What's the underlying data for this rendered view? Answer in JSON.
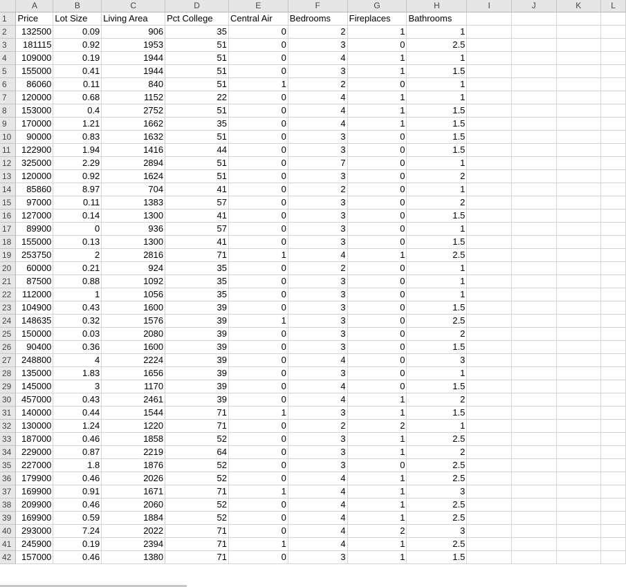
{
  "columns": [
    "A",
    "B",
    "C",
    "D",
    "E",
    "F",
    "G",
    "H",
    "I",
    "J",
    "K",
    "L"
  ],
  "headers": [
    "Price",
    "Lot Size",
    "Living Area",
    "Pct College",
    "Central Air",
    "Bedrooms",
    "Fireplaces",
    "Bathrooms"
  ],
  "rows": [
    [
      132500,
      0.09,
      906,
      35,
      0,
      2,
      1,
      1
    ],
    [
      181115,
      0.92,
      1953,
      51,
      0,
      3,
      0,
      2.5
    ],
    [
      109000,
      0.19,
      1944,
      51,
      0,
      4,
      1,
      1
    ],
    [
      155000,
      0.41,
      1944,
      51,
      0,
      3,
      1,
      1.5
    ],
    [
      86060,
      0.11,
      840,
      51,
      1,
      2,
      0,
      1
    ],
    [
      120000,
      0.68,
      1152,
      22,
      0,
      4,
      1,
      1
    ],
    [
      153000,
      0.4,
      2752,
      51,
      0,
      4,
      1,
      1.5
    ],
    [
      170000,
      1.21,
      1662,
      35,
      0,
      4,
      1,
      1.5
    ],
    [
      90000,
      0.83,
      1632,
      51,
      0,
      3,
      0,
      1.5
    ],
    [
      122900,
      1.94,
      1416,
      44,
      0,
      3,
      0,
      1.5
    ],
    [
      325000,
      2.29,
      2894,
      51,
      0,
      7,
      0,
      1
    ],
    [
      120000,
      0.92,
      1624,
      51,
      0,
      3,
      0,
      2
    ],
    [
      85860,
      8.97,
      704,
      41,
      0,
      2,
      0,
      1
    ],
    [
      97000,
      0.11,
      1383,
      57,
      0,
      3,
      0,
      2
    ],
    [
      127000,
      0.14,
      1300,
      41,
      0,
      3,
      0,
      1.5
    ],
    [
      89900,
      0,
      936,
      57,
      0,
      3,
      0,
      1
    ],
    [
      155000,
      0.13,
      1300,
      41,
      0,
      3,
      0,
      1.5
    ],
    [
      253750,
      2,
      2816,
      71,
      1,
      4,
      1,
      2.5
    ],
    [
      60000,
      0.21,
      924,
      35,
      0,
      2,
      0,
      1
    ],
    [
      87500,
      0.88,
      1092,
      35,
      0,
      3,
      0,
      1
    ],
    [
      112000,
      1,
      1056,
      35,
      0,
      3,
      0,
      1
    ],
    [
      104900,
      0.43,
      1600,
      39,
      0,
      3,
      0,
      1.5
    ],
    [
      148635,
      0.32,
      1576,
      39,
      1,
      3,
      0,
      2.5
    ],
    [
      150000,
      0.03,
      2080,
      39,
      0,
      3,
      0,
      2
    ],
    [
      90400,
      0.36,
      1600,
      39,
      0,
      3,
      0,
      1.5
    ],
    [
      248800,
      4,
      2224,
      39,
      0,
      4,
      0,
      3
    ],
    [
      135000,
      1.83,
      1656,
      39,
      0,
      3,
      0,
      1
    ],
    [
      145000,
      3,
      1170,
      39,
      0,
      4,
      0,
      1.5
    ],
    [
      457000,
      0.43,
      2461,
      39,
      0,
      4,
      1,
      2
    ],
    [
      140000,
      0.44,
      1544,
      71,
      1,
      3,
      1,
      1.5
    ],
    [
      130000,
      1.24,
      1220,
      71,
      0,
      2,
      2,
      1
    ],
    [
      187000,
      0.46,
      1858,
      52,
      0,
      3,
      1,
      2.5
    ],
    [
      229000,
      0.87,
      2219,
      64,
      0,
      3,
      1,
      2
    ],
    [
      227000,
      1.8,
      1876,
      52,
      0,
      3,
      0,
      2.5
    ],
    [
      179900,
      0.46,
      2026,
      52,
      0,
      4,
      1,
      2.5
    ],
    [
      169900,
      0.91,
      1671,
      71,
      1,
      4,
      1,
      3
    ],
    [
      209900,
      0.46,
      2060,
      52,
      0,
      4,
      1,
      2.5
    ],
    [
      169900,
      0.59,
      1884,
      52,
      0,
      4,
      1,
      2.5
    ],
    [
      293000,
      7.24,
      2022,
      71,
      0,
      4,
      2,
      3
    ],
    [
      245900,
      0.19,
      2394,
      71,
      1,
      4,
      1,
      2.5
    ],
    [
      157000,
      0.46,
      1380,
      71,
      0,
      3,
      1,
      1.5
    ]
  ]
}
